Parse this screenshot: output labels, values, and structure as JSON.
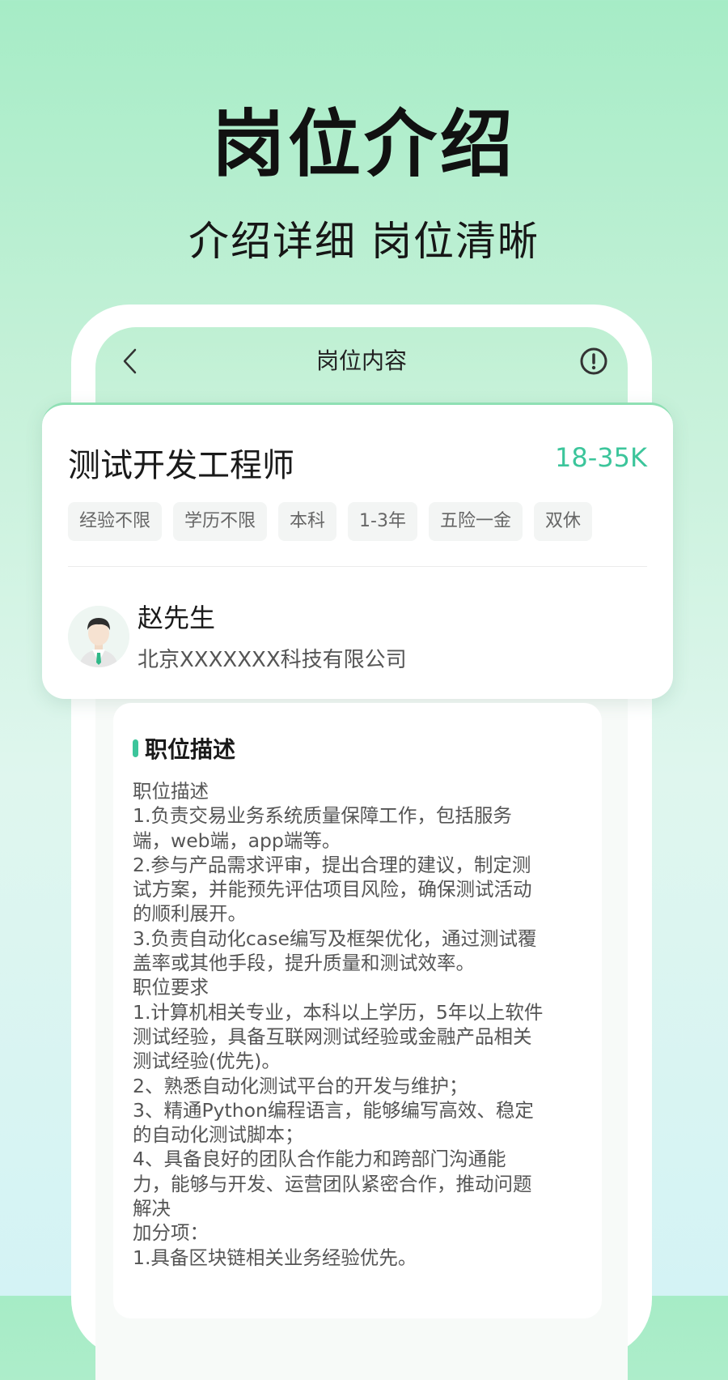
{
  "hero": {
    "title": "岗位介绍",
    "subtitle": "介绍详细 岗位清晰"
  },
  "screen": {
    "title": "岗位内容",
    "back_icon": "chevron-left-icon",
    "info_icon": "exclamation-circle-icon"
  },
  "job": {
    "title": "测试开发工程师",
    "salary": "18-35K",
    "tags": [
      "经验不限",
      "学历不限",
      "本科",
      "1-3年",
      "五险一金",
      "双休"
    ],
    "contact_name": "赵先生",
    "company": "北京XXXXXXX科技有限公司"
  },
  "description": {
    "heading": "职位描述",
    "lines": [
      "职位描述",
      "1.负责交易业务系统质量保障工作，包括服务",
      "端，web端，app端等。",
      "2.参与产品需求评审，提出合理的建议，制定测",
      "试方案，并能预先评估项目风险，确保测试活动",
      "的顺利展开。",
      "3.负责自动化case编写及框架优化，通过测试覆",
      "盖率或其他手段，提升质量和测试效率。",
      "职位要求",
      "1.计算机相关专业，本科以上学历，5年以上软件",
      "测试经验，具备互联网测试经验或金融产品相关",
      "测试经验(优先)。",
      "2、熟悉自动化测试平台的开发与维护；",
      "3、精通Python编程语言，能够编写高效、稳定",
      "的自动化测试脚本；",
      "4、具备良好的团队合作能力和跨部门沟通能",
      "力，能够与开发、运营团队紧密合作，推动问题",
      "解决",
      "加分项：",
      "1.具备区块链相关业务经验优先。"
    ]
  },
  "colors": {
    "accent": "#3cc59b",
    "background_top": "#a6ecc6",
    "background_bottom": "#d4f3f5"
  }
}
